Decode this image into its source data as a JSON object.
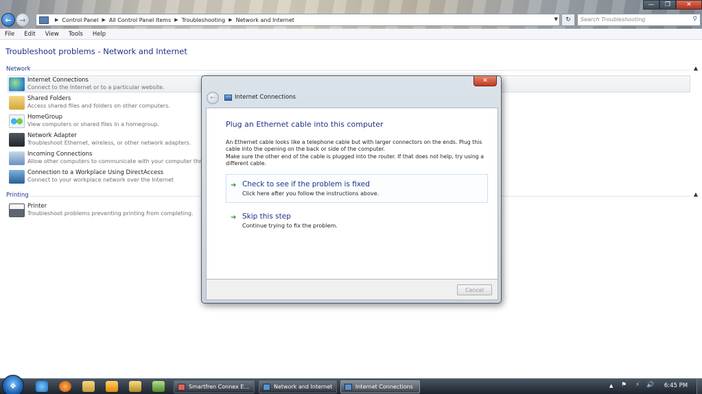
{
  "window": {
    "address": [
      "Control Panel",
      "All Control Panel Items",
      "Troubleshooting",
      "Network and Internet"
    ],
    "search_placeholder": "Search Troubleshooting"
  },
  "menu": [
    "File",
    "Edit",
    "View",
    "Tools",
    "Help"
  ],
  "page": {
    "title": "Troubleshoot problems - Network and Internet",
    "groups": [
      {
        "name": "Network",
        "items": [
          {
            "title": "Internet Connections",
            "desc": "Connect to the Internet or to a particular website.",
            "icon": "globe-icon"
          },
          {
            "title": "Shared Folders",
            "desc": "Access shared files and folders on other computers.",
            "icon": "folder-icon"
          },
          {
            "title": "HomeGroup",
            "desc": "View computers or shared files in a homegroup.",
            "icon": "homegroup-icon"
          },
          {
            "title": "Network Adapter",
            "desc": "Troubleshoot Ethernet, wireless, or other network adapters.",
            "icon": "network-adapter-icon"
          },
          {
            "title": "Incoming Connections",
            "desc": "Allow other computers to communicate with your computer thr",
            "icon": "incoming-connections-icon"
          },
          {
            "title": "Connection to a Workplace Using DirectAccess",
            "desc": "Connect to your workplace network over the Internet",
            "icon": "directaccess-icon"
          }
        ]
      },
      {
        "name": "Printing",
        "items": [
          {
            "title": "Printer",
            "desc": "Troubleshoot problems preventing printing from completing.",
            "icon": "printer-icon"
          }
        ]
      }
    ]
  },
  "dialog": {
    "title": "Internet Connections",
    "heading": "Plug an Ethernet cable into this computer",
    "para1": "An Ethernet cable looks like a telephone cable but with larger connectors on the ends. Plug this cable into the opening on the back or side of the computer.",
    "para2": "Make sure the other end of the cable is plugged into the router. If that does not help, try using a different cable.",
    "options": [
      {
        "title": "Check to see if the problem is fixed",
        "desc": "Click here after you follow the instructions above."
      },
      {
        "title": "Skip this step",
        "desc": "Continue trying to fix the problem."
      }
    ],
    "cancel": "Cancel"
  },
  "taskbar": {
    "tasks": [
      "Smartfren Connex E...",
      "Network and Internet",
      "Internet Connections"
    ],
    "clock": "6:45 PM"
  },
  "colors": {
    "link_blue": "#1e3287",
    "arrow_green": "#2a9a3a",
    "close_red": "#c13b22"
  }
}
